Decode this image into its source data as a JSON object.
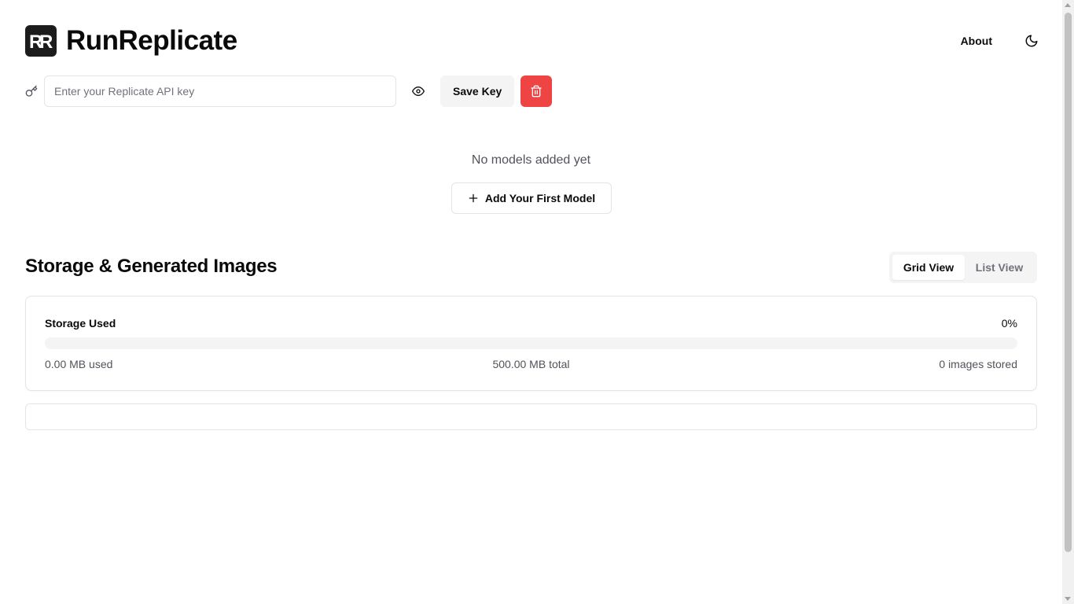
{
  "header": {
    "app_title": "RunReplicate",
    "logo_icon": "rr-logo-icon",
    "about_label": "About",
    "theme_icon": "moon-icon"
  },
  "api_key": {
    "placeholder": "Enter your Replicate API key",
    "value": "",
    "key_icon": "key-icon",
    "toggle_visibility_icon": "eye-icon",
    "save_label": "Save Key",
    "delete_icon": "trash-icon"
  },
  "models": {
    "empty_text": "No models added yet",
    "add_label": "Add Your First Model",
    "add_icon": "plus-icon"
  },
  "storage": {
    "section_title": "Storage & Generated Images",
    "views": [
      {
        "label": "Grid View",
        "active": true
      },
      {
        "label": "List View",
        "active": false
      }
    ],
    "label": "Storage Used",
    "percent_text": "0%",
    "percent_value": 0,
    "used_text": "0.00 MB used",
    "total_text": "500.00 MB total",
    "count_text": "0 images stored"
  },
  "colors": {
    "accent_danger": "#ef4444",
    "text_primary": "#0a0a0a",
    "muted": "#f4f4f5",
    "border": "#e4e4e7"
  }
}
